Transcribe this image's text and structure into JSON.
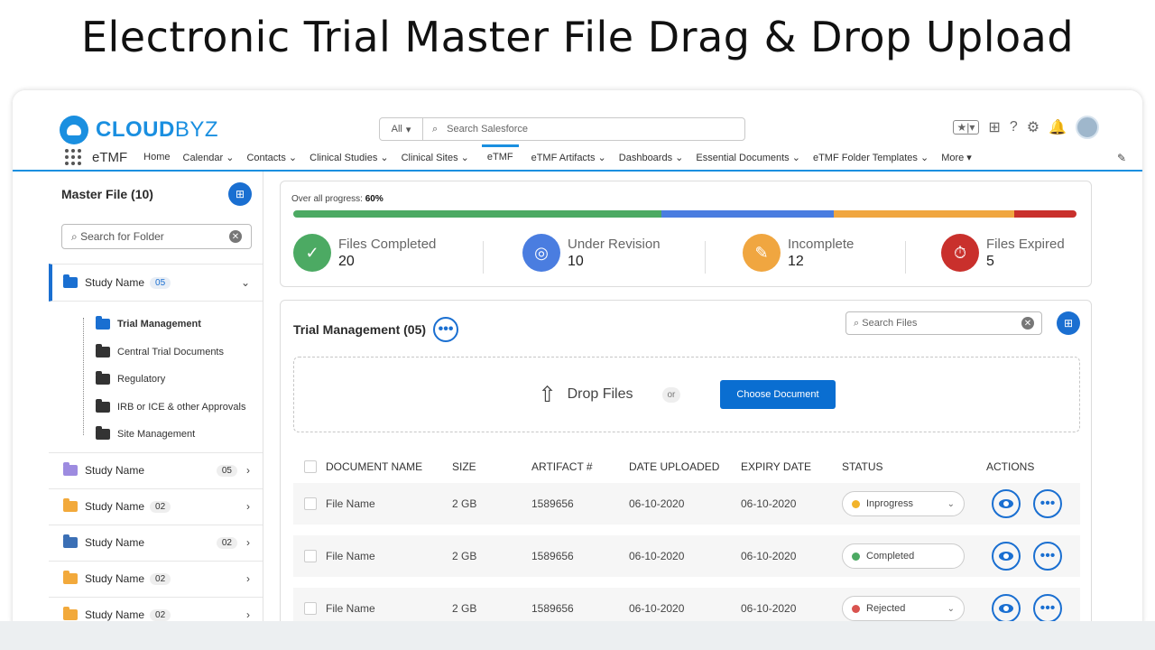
{
  "headline": "Electronic Trial Master File Drag & Drop Upload",
  "colors": {
    "accent": "#1a6fd1",
    "green": "#4caa63",
    "blue": "#4a7de0",
    "orange": "#f0a640",
    "red": "#c9302c"
  },
  "brand": {
    "logo_bold": "CLOUD",
    "logo_thin": "BYZ",
    "app_name": "eTMF"
  },
  "global_search": {
    "scope": "All",
    "placeholder": "Search Salesforce"
  },
  "nav": {
    "items": [
      "Home",
      "Calendar ⌄",
      "Contacts ⌄",
      "Clinical Studies ⌄",
      "Clinical Sites ⌄",
      "eTMF",
      "eTMF Artifacts ⌄",
      "Dashboards ⌄",
      "Essential Documents ⌄",
      "eTMF Folder Templates ⌄",
      "More ▾"
    ],
    "active": "eTMF"
  },
  "sidebar": {
    "title": "Master File (10)",
    "search_placeholder": "Search for Folder",
    "active_study": {
      "name": "Study Name",
      "count": "05"
    },
    "sub_folders": [
      "Trial Management",
      "Central Trial Documents",
      "Regulatory",
      "IRB or ICE & other Approvals",
      "Site Management"
    ],
    "studies": [
      {
        "name": "Study Name",
        "count": "05",
        "folder_color": "#9d8be0"
      },
      {
        "name": "Study Name",
        "count": "02",
        "folder_color": "#f2a93b"
      },
      {
        "name": "Study Name",
        "count": "02",
        "folder_color": "#3b6fb5"
      },
      {
        "name": "Study Name",
        "count": "02",
        "folder_color": "#f2a93b"
      },
      {
        "name": "Study Name",
        "count": "02",
        "folder_color": "#f2a93b"
      }
    ]
  },
  "summary": {
    "progress_label": "Over all progress:",
    "progress_value": "60%",
    "segments": [
      0.47,
      0.22,
      0.23,
      0.08
    ],
    "stats": [
      {
        "label": "Files Completed",
        "value": "20",
        "icon": "check-icon"
      },
      {
        "label": "Under Revision",
        "value": "10",
        "icon": "revision-icon"
      },
      {
        "label": "Incomplete",
        "value": "12",
        "icon": "edit-icon"
      },
      {
        "label": "Files Expired",
        "value": "5",
        "icon": "expired-icon"
      }
    ]
  },
  "panel": {
    "title": "Trial Management (05)",
    "search_placeholder": "Search Files",
    "drop_text": "Drop Files",
    "or": "or",
    "choose_button": "Choose Document",
    "columns": [
      "DOCUMENT NAME",
      "SIZE",
      "ARTIFACT #",
      "DATE UPLOADED",
      "EXPIRY DATE",
      "STATUS",
      "ACTIONS"
    ],
    "rows": [
      {
        "name": "File Name",
        "size": "2 GB",
        "artifact": "1589656",
        "uploaded": "06-10-2020",
        "expiry": "06-10-2020",
        "status": "Inprogress",
        "status_color": "#f2b32a",
        "dropdown": true
      },
      {
        "name": "File Name",
        "size": "2 GB",
        "artifact": "1589656",
        "uploaded": "06-10-2020",
        "expiry": "06-10-2020",
        "status": "Completed",
        "status_color": "#4caa63",
        "dropdown": false
      },
      {
        "name": "File Name",
        "size": "2 GB",
        "artifact": "1589656",
        "uploaded": "06-10-2020",
        "expiry": "06-10-2020",
        "status": "Rejected",
        "status_color": "#d9534f",
        "dropdown": true
      }
    ]
  }
}
